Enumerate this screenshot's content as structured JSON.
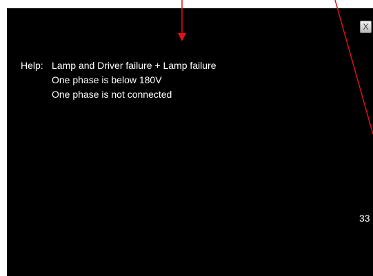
{
  "help": {
    "prefix": "Help:",
    "lines": [
      "Lamp and Driver failure + Lamp failure",
      "One phase is below 180V",
      "One phase is not connected"
    ]
  },
  "close_button": {
    "label": "X",
    "icon": "close-icon"
  },
  "page_counter": "33",
  "colors": {
    "panel_background": "#000000",
    "text": "#ffffff",
    "annotation": "#e0101a"
  }
}
